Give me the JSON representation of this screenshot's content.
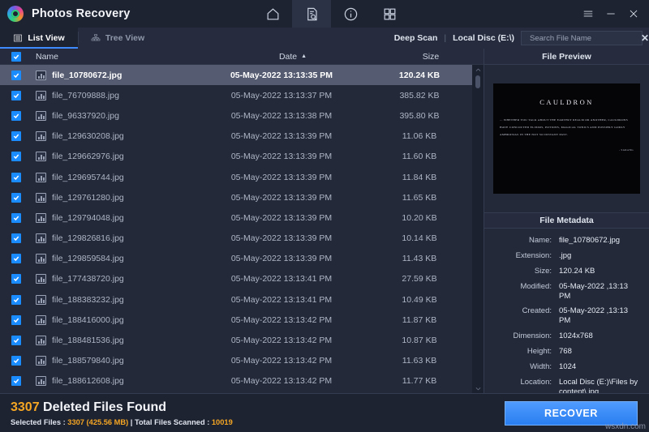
{
  "titlebar": {
    "app_title": "Photos Recovery",
    "logo_icon": "photos-recovery-logo",
    "nav": [
      {
        "name": "home",
        "icon": "home-icon",
        "active": false
      },
      {
        "name": "scan",
        "icon": "document-search-icon",
        "active": true
      },
      {
        "name": "info",
        "icon": "info-circle-icon",
        "active": false
      },
      {
        "name": "grid",
        "icon": "grid-view-icon",
        "active": false
      }
    ],
    "window_controls": [
      {
        "name": "menu",
        "icon": "hamburger-menu-icon"
      },
      {
        "name": "minimize",
        "icon": "minimize-icon"
      },
      {
        "name": "close",
        "icon": "close-icon"
      }
    ]
  },
  "tabbar": {
    "tabs": [
      {
        "label": "List View",
        "icon": "list-view-icon",
        "active": true
      },
      {
        "label": "Tree View",
        "icon": "tree-view-icon",
        "active": false
      }
    ],
    "scan_mode": "Deep Scan",
    "separator": "|",
    "drive": "Local Disc (E:\\)",
    "search_placeholder": "Search File Name",
    "search_value": "",
    "search_icon": "search-icon",
    "search_clear_icon": "clear-icon"
  },
  "table": {
    "columns": {
      "name": "Name",
      "date": "Date",
      "size": "Size"
    },
    "sort_column": "Date",
    "sort_direction": "ascending",
    "header_checkbox_checked": true,
    "rows": [
      {
        "name": "file_10780672.jpg",
        "date": "05-May-2022 13:13:35 PM",
        "size": "120.24 KB",
        "checked": true,
        "selected": true
      },
      {
        "name": "file_76709888.jpg",
        "date": "05-May-2022 13:13:37 PM",
        "size": "385.82 KB",
        "checked": true,
        "selected": false
      },
      {
        "name": "file_96337920.jpg",
        "date": "05-May-2022 13:13:38 PM",
        "size": "395.80 KB",
        "checked": true,
        "selected": false
      },
      {
        "name": "file_129630208.jpg",
        "date": "05-May-2022 13:13:39 PM",
        "size": "11.06 KB",
        "checked": true,
        "selected": false
      },
      {
        "name": "file_129662976.jpg",
        "date": "05-May-2022 13:13:39 PM",
        "size": "11.60 KB",
        "checked": true,
        "selected": false
      },
      {
        "name": "file_129695744.jpg",
        "date": "05-May-2022 13:13:39 PM",
        "size": "11.84 KB",
        "checked": true,
        "selected": false
      },
      {
        "name": "file_129761280.jpg",
        "date": "05-May-2022 13:13:39 PM",
        "size": "11.65 KB",
        "checked": true,
        "selected": false
      },
      {
        "name": "file_129794048.jpg",
        "date": "05-May-2022 13:13:39 PM",
        "size": "10.20 KB",
        "checked": true,
        "selected": false
      },
      {
        "name": "file_129826816.jpg",
        "date": "05-May-2022 13:13:39 PM",
        "size": "10.14 KB",
        "checked": true,
        "selected": false
      },
      {
        "name": "file_129859584.jpg",
        "date": "05-May-2022 13:13:39 PM",
        "size": "11.43 KB",
        "checked": true,
        "selected": false
      },
      {
        "name": "file_177438720.jpg",
        "date": "05-May-2022 13:13:41 PM",
        "size": "27.59 KB",
        "checked": true,
        "selected": false
      },
      {
        "name": "file_188383232.jpg",
        "date": "05-May-2022 13:13:41 PM",
        "size": "10.49 KB",
        "checked": true,
        "selected": false
      },
      {
        "name": "file_188416000.jpg",
        "date": "05-May-2022 13:13:42 PM",
        "size": "11.87 KB",
        "checked": true,
        "selected": false
      },
      {
        "name": "file_188481536.jpg",
        "date": "05-May-2022 13:13:42 PM",
        "size": "10.87 KB",
        "checked": true,
        "selected": false
      },
      {
        "name": "file_188579840.jpg",
        "date": "05-May-2022 13:13:42 PM",
        "size": "11.63 KB",
        "checked": true,
        "selected": false
      },
      {
        "name": "file_188612608.jpg",
        "date": "05-May-2022 13:13:42 PM",
        "size": "11.77 KB",
        "checked": true,
        "selected": false
      }
    ]
  },
  "preview": {
    "title": "File Preview",
    "image_title": "CAULDRON",
    "image_body": "... WHETHER YOU TALK ABOUT THE EARTHLY REALM OR ANOTHER, CAULDRONS HAVE CONCOCTED ELIXIRS, POTIONS, MAGICAL TONICS AND POSSIBLY GODLY AMBROSIAS IN THE NOT SO DISTANT PAST.",
    "image_signature": "- SARANG"
  },
  "metadata": {
    "title": "File Metadata",
    "fields": [
      {
        "key": "Name:",
        "value": "file_10780672.jpg"
      },
      {
        "key": "Extension:",
        "value": ".jpg"
      },
      {
        "key": "Size:",
        "value": "120.24 KB"
      },
      {
        "key": "Modified:",
        "value": "05-May-2022 ,13:13 PM"
      },
      {
        "key": "Created:",
        "value": "05-May-2022 ,13:13 PM"
      },
      {
        "key": "Dimension:",
        "value": "1024x768"
      },
      {
        "key": "Height:",
        "value": "768"
      },
      {
        "key": "Width:",
        "value": "1024"
      },
      {
        "key": "Location:",
        "value": "Local Disc (E:)\\Files by content\\.jpg"
      }
    ]
  },
  "footer": {
    "found_count": "3307",
    "found_label": "Deleted Files Found",
    "selected_label": "Selected Files : ",
    "selected_value": "3307 (425.56 MB)",
    "pipe": " | ",
    "scanned_label": "Total Files Scanned : ",
    "scanned_value": "10019",
    "recover_label": "RECOVER",
    "watermark": "wsxdn.com"
  },
  "colors": {
    "accent_blue": "#1a8cff",
    "accent_orange": "#f5a623",
    "titlebar_bg": "#1e2332",
    "panel_bg": "#232939",
    "header_bg": "#262c3d",
    "selected_row": "#555b70"
  }
}
